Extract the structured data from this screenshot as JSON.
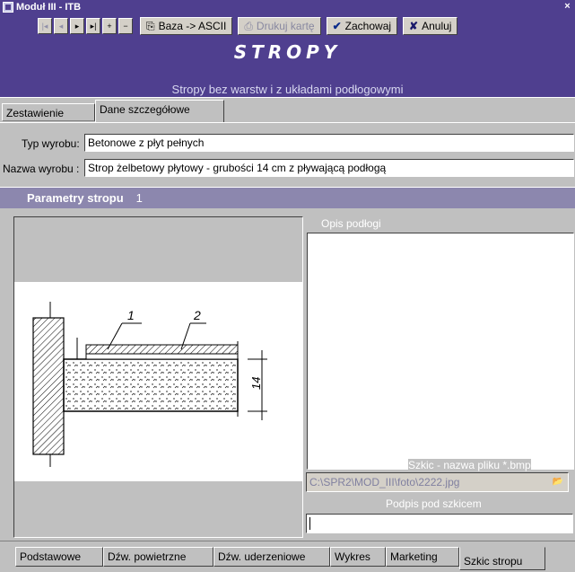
{
  "window": {
    "title": "Moduł III - ITB",
    "close_glyph": "×"
  },
  "toolbar": {
    "nav": [
      "|◂",
      "◂",
      "▸",
      "▸|",
      "+",
      "−"
    ],
    "baza_label": "Baza -> ASCII",
    "drukuj_label": "Drukuj kartę",
    "zachowaj_label": "Zachowaj",
    "anuluj_label": "Anuluj"
  },
  "header": {
    "title": "STROPY",
    "subtitle": "Stropy bez warstw i z układami podłogowymi"
  },
  "tabs_top": [
    "Zestawienie",
    "Dane szczegółowe"
  ],
  "fields": {
    "typ_label": "Typ wyrobu:",
    "typ_value": "Betonowe z płyt pełnych",
    "nazwa_label": "Nazwa wyrobu :",
    "nazwa_value": "Strop żelbetowy płytowy - grubości 14 cm z pływającą podłogą"
  },
  "params": {
    "label": "Parametry stropu",
    "number": "1"
  },
  "opis": {
    "label": "Opis podłogi",
    "value": ""
  },
  "szkic": {
    "label": "Szkic - nazwa pliku *.bmp",
    "value": "C:\\SPR2\\MOD_III\\foto\\2222.jpg"
  },
  "podpis": {
    "label": "Podpis pod szkicem",
    "value": ""
  },
  "sketch": {
    "callout_1": "1",
    "callout_2": "2",
    "dimension": "14"
  },
  "tabs_bottom": [
    "Podstawowe",
    "Dźw. powietrzne",
    "Dźw. uderzeniowe",
    "Wykres",
    "Marketing",
    "Szkic stropu"
  ],
  "active_tab": "Szkic stropu",
  "colors": {
    "primary": "#4f3f8f",
    "params_bar": "#8c87ae",
    "face": "#c0c0c0"
  }
}
